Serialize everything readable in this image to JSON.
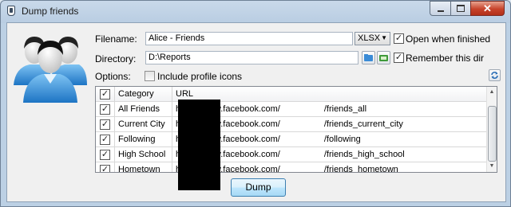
{
  "window": {
    "title": "Dump friends"
  },
  "form": {
    "filename_label": "Filename:",
    "filename_value": "Alice - Friends",
    "format_value": "XLSX",
    "open_when_finished_label": "Open when finished",
    "open_when_finished_checked": true,
    "directory_label": "Directory:",
    "directory_value": "D:\\Reports",
    "remember_dir_label": "Remember this dir",
    "remember_dir_checked": true,
    "options_label": "Options:",
    "include_profile_icons_label": "Include profile icons",
    "include_profile_icons_checked": false
  },
  "table": {
    "columns": [
      "",
      "Category",
      "URL"
    ],
    "rows": [
      {
        "checked": true,
        "category": "All Friends",
        "url_prefix": "https://www.facebook.com/",
        "url_suffix": "/friends_all"
      },
      {
        "checked": true,
        "category": "Current City",
        "url_prefix": "https://www.facebook.com/",
        "url_suffix": "/friends_current_city"
      },
      {
        "checked": true,
        "category": "Following",
        "url_prefix": "https://www.facebook.com/",
        "url_suffix": "/following"
      },
      {
        "checked": true,
        "category": "High School",
        "url_prefix": "https://www.facebook.com/",
        "url_suffix": "/friends_high_school"
      },
      {
        "checked": true,
        "category": "Hometown",
        "url_prefix": "https://www.facebook.com/",
        "url_suffix": "/friends_hometown"
      }
    ]
  },
  "actions": {
    "dump_label": "Dump"
  },
  "icons": {
    "app": "app-icon",
    "users": "users-group-icon",
    "folder": "folder-icon",
    "open_folder": "open-folder-icon",
    "refresh": "refresh-icon"
  },
  "colors": {
    "accent": "#3c7fb1",
    "close_button": "#c7432b"
  }
}
